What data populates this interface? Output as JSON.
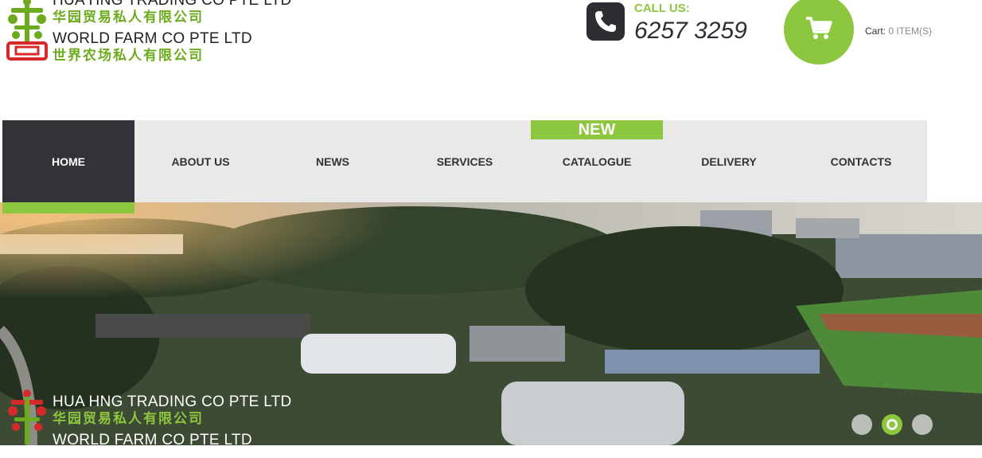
{
  "brand": {
    "company_line_1": "HUA HNG TRADING CO PTE LTD",
    "chinese_line_1": "华园贸易私人有限公司",
    "company_line_2": "WORLD FARM CO PTE LTD",
    "chinese_line_2": "世界农场私人有限公司"
  },
  "contact": {
    "call_label": "CALL US:",
    "phone": "6257 3259",
    "icon": "phone-icon"
  },
  "cart": {
    "label": "Cart:",
    "count": "0 ITEM(S)",
    "icon": "cart-icon"
  },
  "nav": {
    "items": [
      "HOME",
      "ABOUT US",
      "NEWS",
      "SERVICES",
      "CATALOGUE",
      "DELIVERY",
      "CONTACTS"
    ],
    "active": "HOME",
    "badge": "NEW"
  },
  "hero": {
    "slide_count": 3,
    "active_slide": 2
  },
  "colors": {
    "accent": "#8dc63f",
    "dark": "#333238",
    "nav_bg": "#e9e9e9",
    "logo_red": "#d62a2a"
  }
}
